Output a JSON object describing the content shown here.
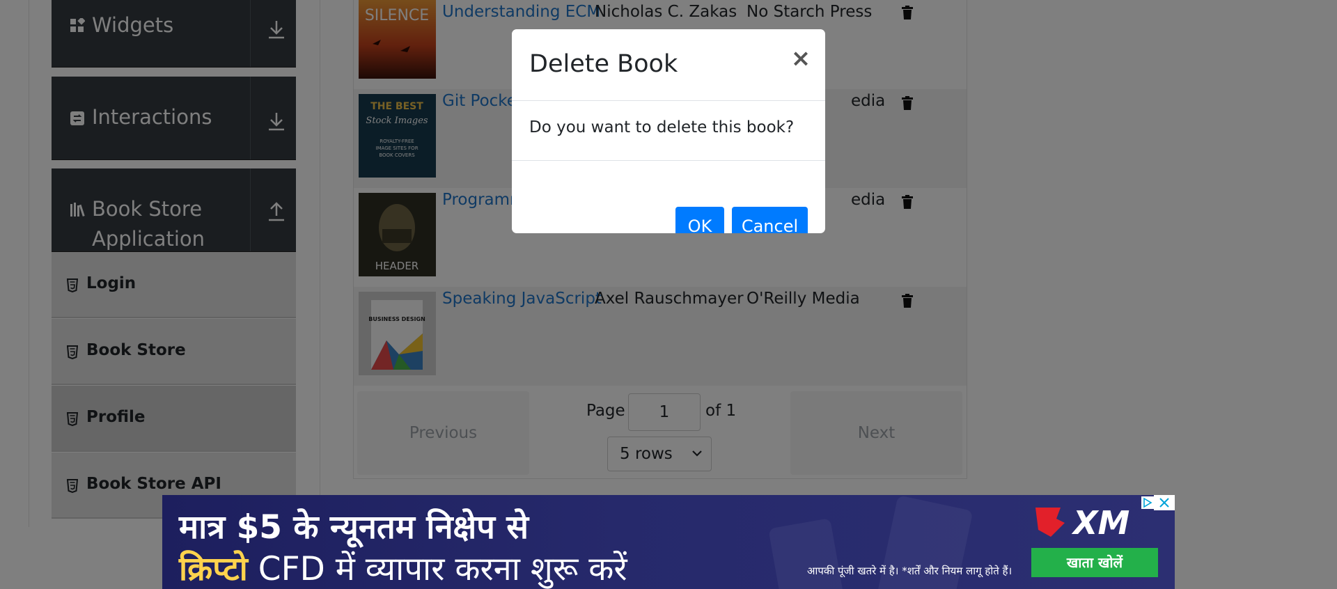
{
  "sidebar": {
    "groups": [
      {
        "label": "Widgets",
        "icon": "widgets-icon"
      },
      {
        "label": "Interactions",
        "icon": "interactions-icon"
      },
      {
        "label_line1": "Book Store",
        "label_line2": "Application",
        "icon": "bookshelf-icon"
      }
    ],
    "items": [
      {
        "label": "Login"
      },
      {
        "label": "Book Store"
      },
      {
        "label": "Profile",
        "active": true
      },
      {
        "label": "Book Store API"
      }
    ]
  },
  "books": {
    "rows": [
      {
        "title": "Understanding ECM",
        "author": "Nicholas C. Zakas",
        "publisher": "No Starch Press"
      },
      {
        "title": "Git Pocket",
        "author": "",
        "publisher": "edia"
      },
      {
        "title": "Programm",
        "author": "",
        "publisher": "edia"
      },
      {
        "title": "Speaking JavaScript",
        "author": "Axel Rauschmayer",
        "publisher": "O'Reilly Media"
      }
    ],
    "cover_texts": {
      "silence": "SILENCE",
      "best_line1": "THE BEST",
      "best_line2": "Stock Images",
      "best_line3": "ROYALTY-FREE",
      "best_line4": "IMAGE SITES FOR",
      "best_line5": "BOOK COVERS",
      "header": "HEADER",
      "business": "BUSINESS DESIGN"
    }
  },
  "pagination": {
    "previous": "Previous",
    "next": "Next",
    "page_label": "Page",
    "page_value": "1",
    "of_label": "of 1",
    "rows_option": "5 rows"
  },
  "modal": {
    "title": "Delete Book",
    "close": "×",
    "body": "Do you want to delete this book?",
    "ok": "OK",
    "cancel": "Cancel"
  },
  "ad": {
    "line1": "मात्र $5 के न्यूनतम निक्षेप से",
    "line2_highlight": "क्रिप्टो",
    "line2_rest": " CFD में  व्यापार करना शुरू करें",
    "disclaimer": "आपकी पूंजी खतरे में है। *शर्तें और नियम लागू होते हैं।",
    "brand": "XM",
    "cta": "खाता खोलें"
  },
  "colors": {
    "accent": "#007bff",
    "link": "#1e74c8",
    "sidebar_dark": "#343a40",
    "ad_bg": "#25286a",
    "ad_cta": "#23b04a"
  }
}
